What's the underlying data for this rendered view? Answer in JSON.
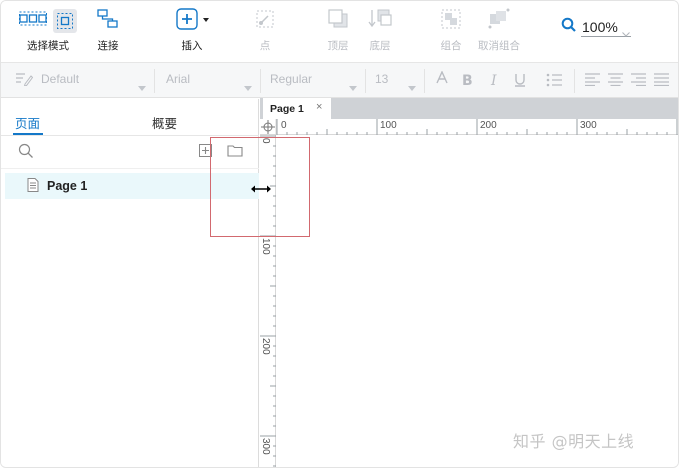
{
  "toolbar": {
    "select_mode_label": "选择模式",
    "connect_label": "连接",
    "insert_label": "插入",
    "point_label": "点",
    "top_layer_label": "顶层",
    "bottom_layer_label": "底层",
    "group_label": "组合",
    "ungroup_label": "取消组合",
    "zoom_value": "100%",
    "accent_color": "#1478c8"
  },
  "format_bar": {
    "style_value": "Default",
    "font_value": "Arial",
    "weight_value": "Regular",
    "size_value": "13",
    "disabled_color": "#b9bcc2"
  },
  "left_panel": {
    "tabs": [
      {
        "label": "页面",
        "active": true
      },
      {
        "label": "概要",
        "active": false
      }
    ],
    "pages": [
      {
        "label": "Page 1",
        "selected": true
      }
    ]
  },
  "canvas": {
    "tabs": [
      {
        "label": "Page 1",
        "close": "×"
      }
    ],
    "ruler_h_labels": [
      "0",
      "100",
      "200",
      "300"
    ],
    "ruler_v_labels": [
      "0",
      "100",
      "200",
      "300"
    ]
  },
  "watermark": "知乎 @明天上线",
  "icons": [
    "select-mode-icon",
    "select-box-icon",
    "connect-icon",
    "insert-icon",
    "point-icon",
    "bring-top-icon",
    "send-bottom-icon",
    "group-icon",
    "ungroup-icon",
    "zoom-search-icon",
    "search-icon",
    "add-page-icon",
    "folder-icon",
    "page-doc-icon",
    "resize-cursor-icon"
  ]
}
